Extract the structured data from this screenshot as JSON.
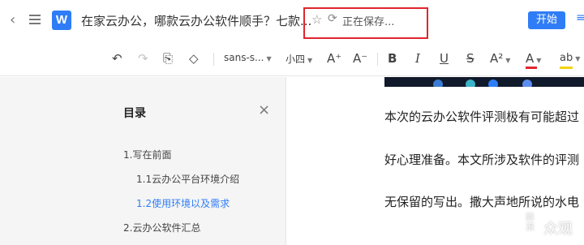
{
  "titlebar": {
    "back_glyph": "‹",
    "logo_letter": "W",
    "doc_title": "在家云办公，哪款云办公软件顺手？七款...",
    "save_status": "正在保存...",
    "start_button": "开始",
    "more_glyph": "≡"
  },
  "toolbar": {
    "undo": "↶",
    "redo": "↷",
    "format_painter": "⎘",
    "clear_format": "◇",
    "font_family": "sans-s...",
    "font_size": "小四",
    "grow_font": "A⁺",
    "shrink_font": "A⁻",
    "bold": "B",
    "italic": "I",
    "underline": "U",
    "strike": "S",
    "text_effect": "A²",
    "font_color": "A",
    "highlight": "ab",
    "font_color_hex": "#e0262d",
    "highlight_hex": "#f5d30f"
  },
  "toc": {
    "title": "目录",
    "close_glyph": "×",
    "items": [
      {
        "label": "1.写在前面"
      },
      {
        "label": "1.1云办公平台环境介绍"
      },
      {
        "label": "1.2使用环境以及需求"
      },
      {
        "label": "2.云办公软件汇总"
      }
    ]
  },
  "document": {
    "paragraphs": [
      "本次的云办公软件评测极有可能超过",
      "好心理准备。本文所涉及软件的评测",
      "无保留的写出。撒大声地所说的水电"
    ]
  },
  "watermark": {
    "logo_text": "新浪",
    "text": "众观"
  },
  "colors": {
    "accent": "#2f7df6",
    "highlight_box": "#e0262d"
  }
}
